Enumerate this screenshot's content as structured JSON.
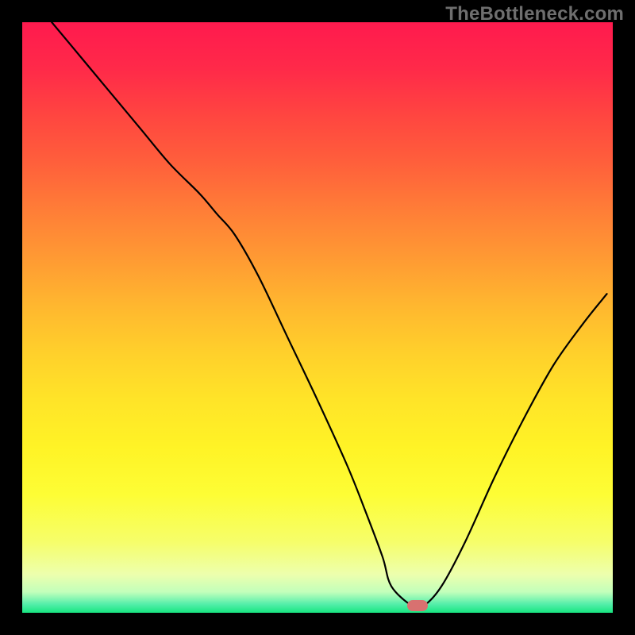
{
  "attribution": "TheBottleneck.com",
  "chart_data": {
    "type": "line",
    "title": "",
    "xlabel": "",
    "ylabel": "",
    "xlim": [
      0,
      100
    ],
    "ylim": [
      0,
      100
    ],
    "grid": false,
    "legend": false,
    "background_gradient": {
      "stops": [
        {
          "offset": 0.0,
          "color": "#ff1a4e"
        },
        {
          "offset": 0.08,
          "color": "#ff2a49"
        },
        {
          "offset": 0.16,
          "color": "#ff4640"
        },
        {
          "offset": 0.24,
          "color": "#ff603b"
        },
        {
          "offset": 0.32,
          "color": "#ff7e37"
        },
        {
          "offset": 0.4,
          "color": "#ff9a33"
        },
        {
          "offset": 0.48,
          "color": "#ffb72f"
        },
        {
          "offset": 0.56,
          "color": "#ffd02b"
        },
        {
          "offset": 0.64,
          "color": "#ffe428"
        },
        {
          "offset": 0.72,
          "color": "#fff326"
        },
        {
          "offset": 0.8,
          "color": "#fdfd35"
        },
        {
          "offset": 0.88,
          "color": "#f6fe6a"
        },
        {
          "offset": 0.935,
          "color": "#edffad"
        },
        {
          "offset": 0.965,
          "color": "#c2ffbb"
        },
        {
          "offset": 0.985,
          "color": "#56efab"
        },
        {
          "offset": 1.0,
          "color": "#17e580"
        }
      ]
    },
    "series": [
      {
        "name": "bottleneck-curve",
        "stroke": "#000000",
        "stroke_width": 2.2,
        "x": [
          5.0,
          10.0,
          15.0,
          20.0,
          25.0,
          30.0,
          33.0,
          36.0,
          40.0,
          45.0,
          50.0,
          55.0,
          58.0,
          61.0,
          62.5,
          66.0,
          68.0,
          71.0,
          75.0,
          80.0,
          85.0,
          90.0,
          95.0,
          99.0
        ],
        "y": [
          100.0,
          94.0,
          88.0,
          82.0,
          76.0,
          71.0,
          67.5,
          64.0,
          57.0,
          46.5,
          36.0,
          25.0,
          17.5,
          9.5,
          4.5,
          1.2,
          1.2,
          4.5,
          12.0,
          23.0,
          33.0,
          42.0,
          49.0,
          54.0
        ]
      }
    ],
    "marker": {
      "name": "optimal-point",
      "x": 67.0,
      "y": 1.2,
      "color": "#d87170"
    }
  }
}
